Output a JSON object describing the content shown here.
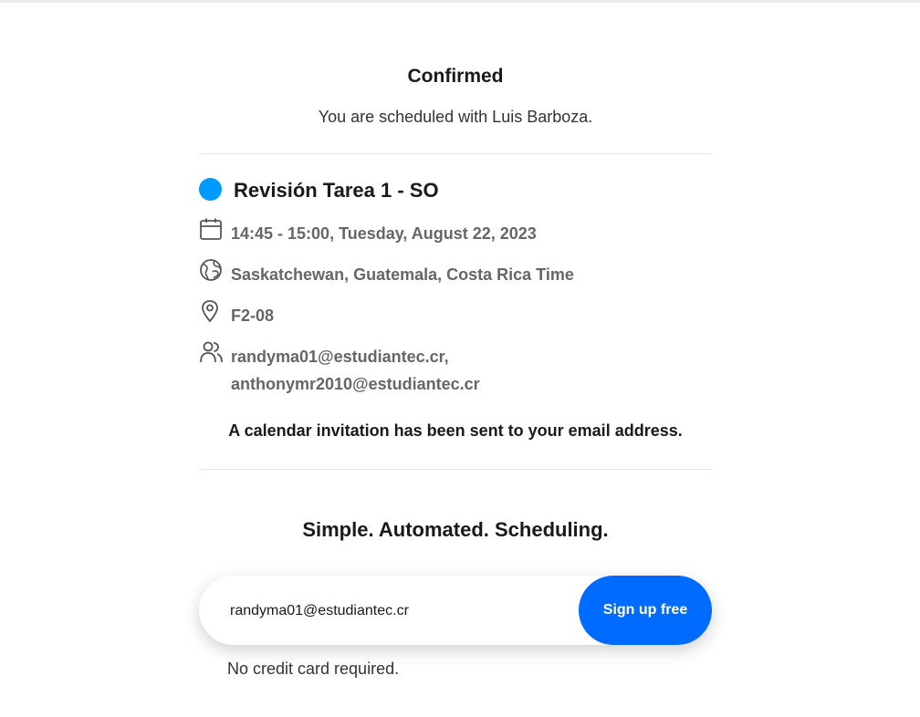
{
  "header": {
    "title": "Confirmed",
    "subtitle": "You are scheduled with Luis Barboza."
  },
  "event": {
    "name": "Revisión Tarea 1 - SO",
    "color": "#0099ff",
    "datetime": "14:45 - 15:00, Tuesday, August 22, 2023",
    "timezone": "Saskatchewan, Guatemala, Costa Rica Time",
    "location": "F2-08",
    "invitees_line1": "randyma01@estudiantec.cr,",
    "invitees_line2": "anthonymr2010@estudiantec.cr",
    "icons": [
      "calendar-icon",
      "globe-icon",
      "location-pin-icon",
      "people-icon"
    ]
  },
  "invite_note": "A calendar invitation has been sent to your email address.",
  "promo": {
    "heading": "Simple. Automated. Scheduling.",
    "email_value": "randyma01@estudiantec.cr",
    "button_label": "Sign up free",
    "button_color": "#006bff",
    "footnote": "No credit card required."
  }
}
